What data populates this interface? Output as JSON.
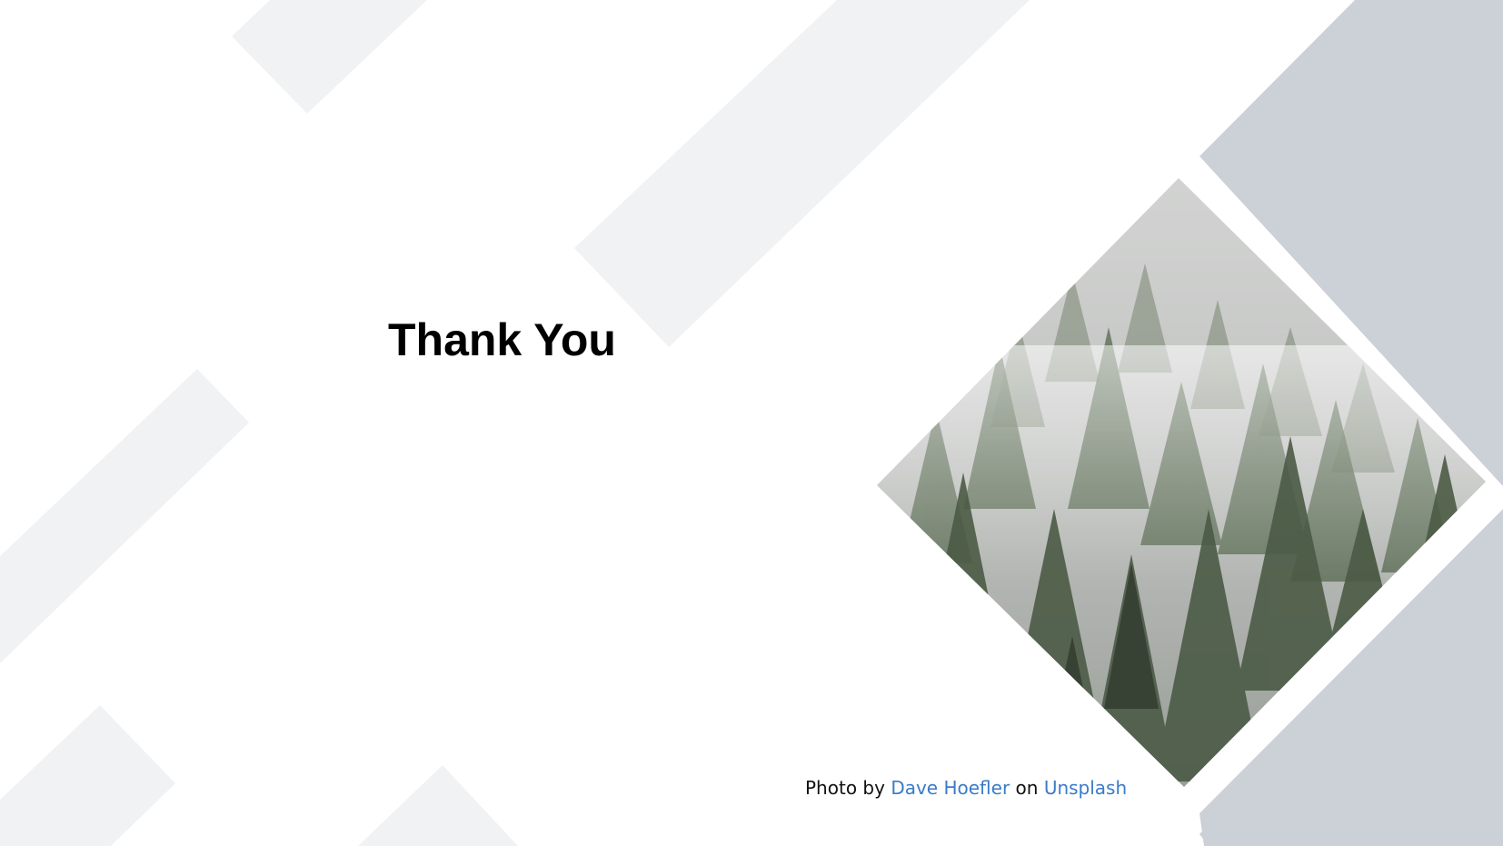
{
  "slide": {
    "title": "Thank You",
    "credit": {
      "prefix": "Photo by",
      "author": "Dave Hoefler",
      "middle": "on",
      "site": "Unsplash"
    },
    "photo": {
      "subject": "foggy pine forest"
    }
  },
  "colors": {
    "background": "#ffffff",
    "light_stripe": "#f1f2f4",
    "dark_panel": "#ccd0d7",
    "link": "#3a7bc8",
    "title": "#000000"
  }
}
